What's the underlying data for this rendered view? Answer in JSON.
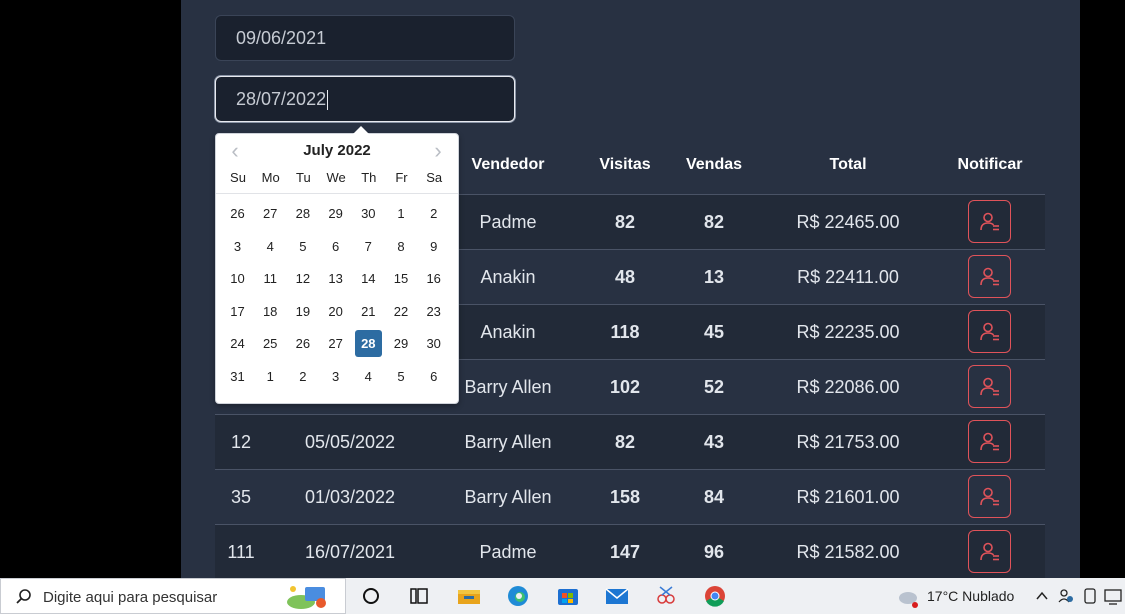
{
  "filters": {
    "min_date": "09/06/2021",
    "max_date": "28/07/2022"
  },
  "datepicker": {
    "month_label": "July 2022",
    "weekdays": [
      "Su",
      "Mo",
      "Tu",
      "We",
      "Th",
      "Fr",
      "Sa"
    ],
    "weeks": [
      [
        "26",
        "27",
        "28",
        "29",
        "30",
        "1",
        "2"
      ],
      [
        "3",
        "4",
        "5",
        "6",
        "7",
        "8",
        "9"
      ],
      [
        "10",
        "11",
        "12",
        "13",
        "14",
        "15",
        "16"
      ],
      [
        "17",
        "18",
        "19",
        "20",
        "21",
        "22",
        "23"
      ],
      [
        "24",
        "25",
        "26",
        "27",
        "28",
        "29",
        "30"
      ],
      [
        "31",
        "1",
        "2",
        "3",
        "4",
        "5",
        "6"
      ]
    ],
    "selected_day": "28",
    "prev_icon": "chevron-left-icon",
    "next_icon": "chevron-right-icon"
  },
  "table": {
    "headers": [
      "Vendedor",
      "Visitas",
      "Vendas",
      "Total",
      "Notificar"
    ],
    "rows": [
      {
        "id": "",
        "date": "",
        "seller": "Padme",
        "visits": "82",
        "sales": "82",
        "total": "R$ 22465.00"
      },
      {
        "id": "",
        "date": "",
        "seller": "Anakin",
        "visits": "48",
        "sales": "13",
        "total": "R$ 22411.00"
      },
      {
        "id": "",
        "date": "",
        "seller": "Anakin",
        "visits": "118",
        "sales": "45",
        "total": "R$ 22235.00"
      },
      {
        "id": "",
        "date": "",
        "seller": "Barry Allen",
        "visits": "102",
        "sales": "52",
        "total": "R$ 22086.00"
      },
      {
        "id": "12",
        "date": "05/05/2022",
        "seller": "Barry Allen",
        "visits": "82",
        "sales": "43",
        "total": "R$ 21753.00"
      },
      {
        "id": "35",
        "date": "01/03/2022",
        "seller": "Barry Allen",
        "visits": "158",
        "sales": "84",
        "total": "R$ 21601.00"
      },
      {
        "id": "111",
        "date": "16/07/2021",
        "seller": "Padme",
        "visits": "147",
        "sales": "96",
        "total": "R$ 21582.00"
      }
    ],
    "notify_icon": "notify-user-icon"
  },
  "taskbar": {
    "search_placeholder": "Digite aqui para pesquisar",
    "weather": "17°C  Nublado",
    "icons": [
      "search-icon",
      "weather-widget-icon",
      "cortana-icon",
      "task-view-icon",
      "file-explorer-icon",
      "edge-icon",
      "store-icon",
      "mail-icon",
      "snip-icon",
      "chrome-icon"
    ]
  },
  "colors": {
    "page_bg": "#283142",
    "input_bg": "#1a212e",
    "accent_red": "#e0535a",
    "selected_day": "#2d6ca2"
  }
}
